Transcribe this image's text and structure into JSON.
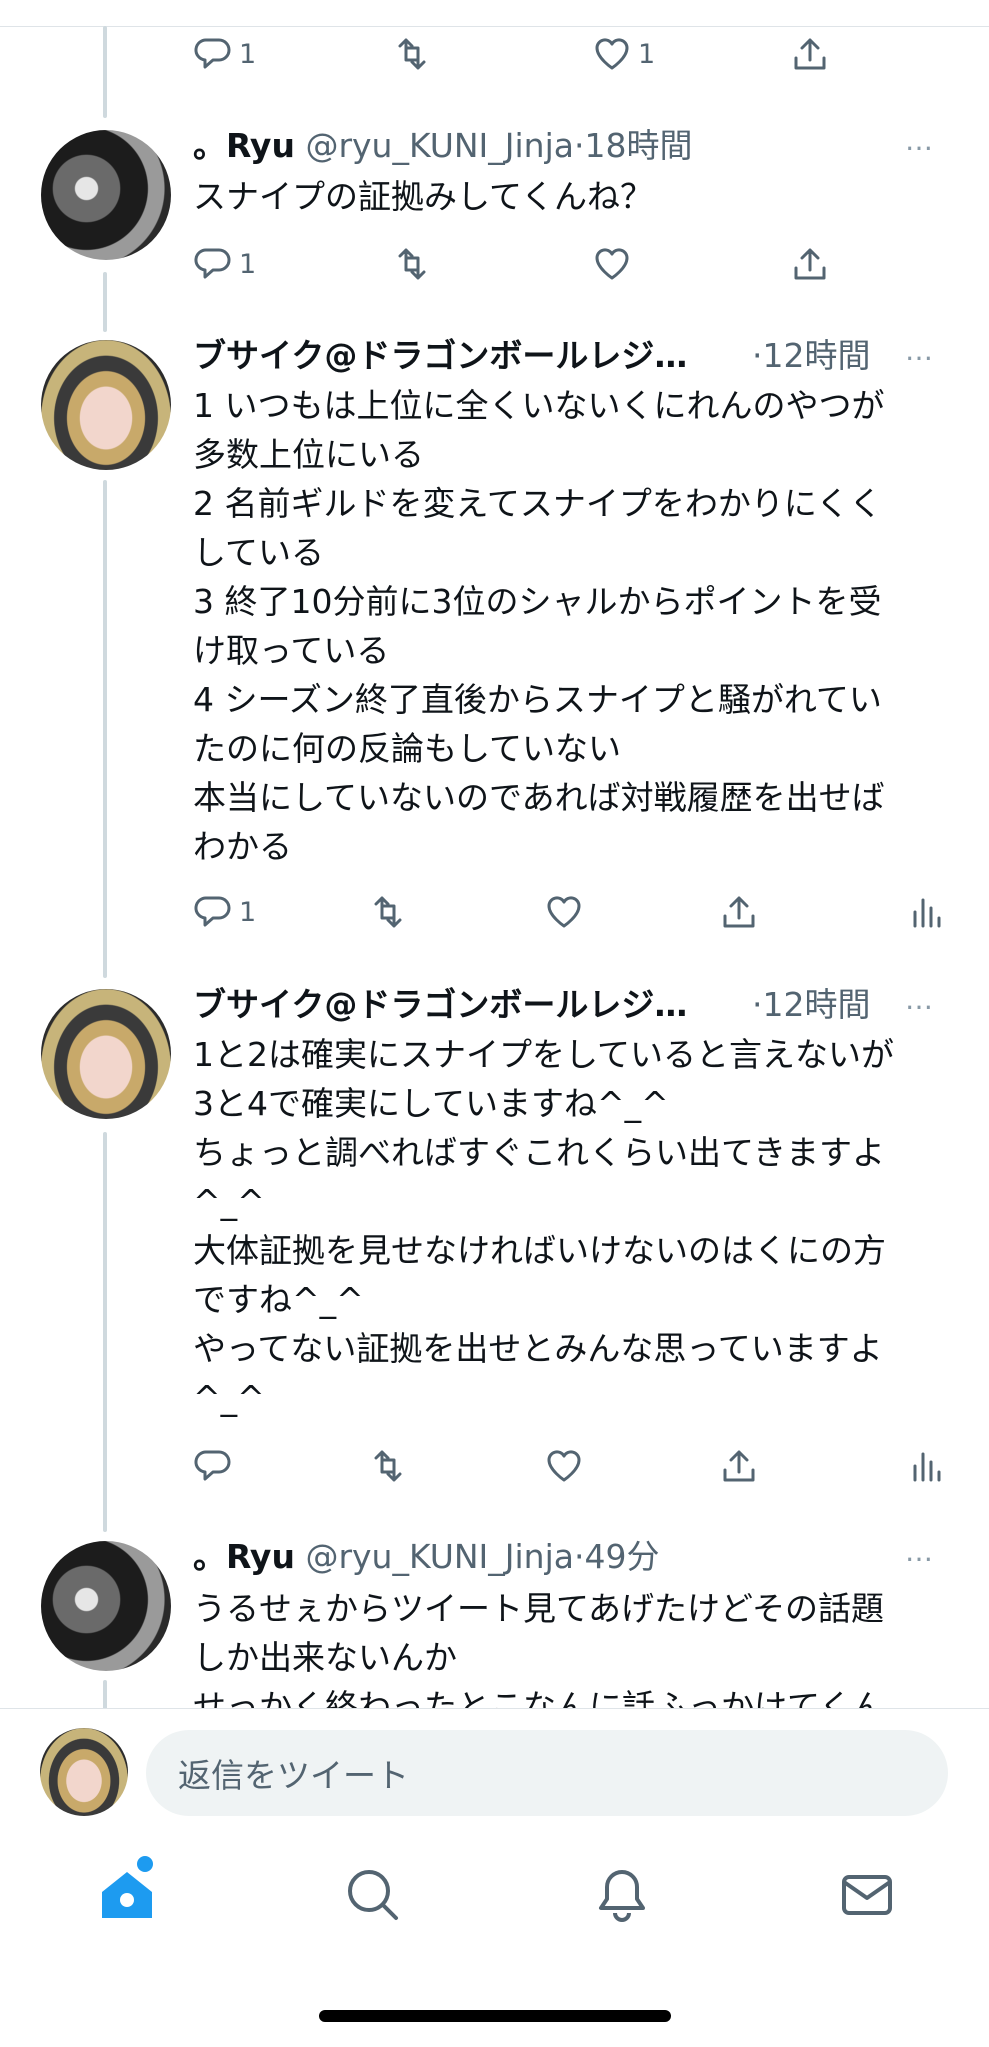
{
  "colors": {
    "accent": "#1d9bf0",
    "text": "#0f1419",
    "muted": "#536471",
    "thread_line": "#cfd9de"
  },
  "tweets": [
    {
      "actions": {
        "reply_count": "1",
        "retweet_count": "",
        "like_count": "1",
        "analytics": false
      }
    },
    {
      "name": "。Ryu",
      "handle": "@ryu_KUNI_Jinja",
      "time": "·18時間",
      "text": "スナイプの証拠みしてくんね？",
      "actions": {
        "reply_count": "1",
        "retweet_count": "",
        "like_count": "",
        "analytics": false
      }
    },
    {
      "name": "ブサイク@ドラゴンボールレジ…",
      "handle": "",
      "time": "·12時間",
      "text": "1 いつもは上位に全くいないくにれんのやつが\n多数上位にいる\n2 名前ギルドを変えてスナイプをわかりにくく\nしている\n3 終了10分前に3位のシャルからポイントを受\nけ取っている\n4 シーズン終了直後からスナイプと騒がれてい\nたのに何の反論もしていない\n本当にしていないのであれば対戦履歴を出せば\nわかる",
      "actions": {
        "reply_count": "1",
        "retweet_count": "",
        "like_count": "",
        "analytics": true
      }
    },
    {
      "name": "ブサイク@ドラゴンボールレジ…",
      "handle": "",
      "time": "·12時間",
      "text": "1と2は確実にスナイプをしていると言えないが\n3と4で確実にしていますね^_^\nちょっと調べればすぐこれくらい出てきますよ\n^_^\n大体証拠を見せなければいけないのはくにの方\nですね^_^\nやってない証拠を出せとみんな思っていますよ\n^_^",
      "actions": {
        "reply_count": "",
        "retweet_count": "",
        "like_count": "",
        "analytics": true
      }
    },
    {
      "name": "。Ryu",
      "handle": "@ryu_KUNI_Jinja",
      "time": "·49分",
      "text": "うるせぇからツイート見てあげたけどその話題\nしか出来ないんか\nせっかく終わったとこなんに話ふっかけてくん",
      "actions": null
    }
  ],
  "more_icon": "…",
  "reply": {
    "placeholder": "返信をツイート"
  },
  "nav": [
    {
      "icon": "home-icon",
      "active": true
    },
    {
      "icon": "search-icon",
      "active": false
    },
    {
      "icon": "bell-icon",
      "active": false
    },
    {
      "icon": "mail-icon",
      "active": false
    }
  ]
}
